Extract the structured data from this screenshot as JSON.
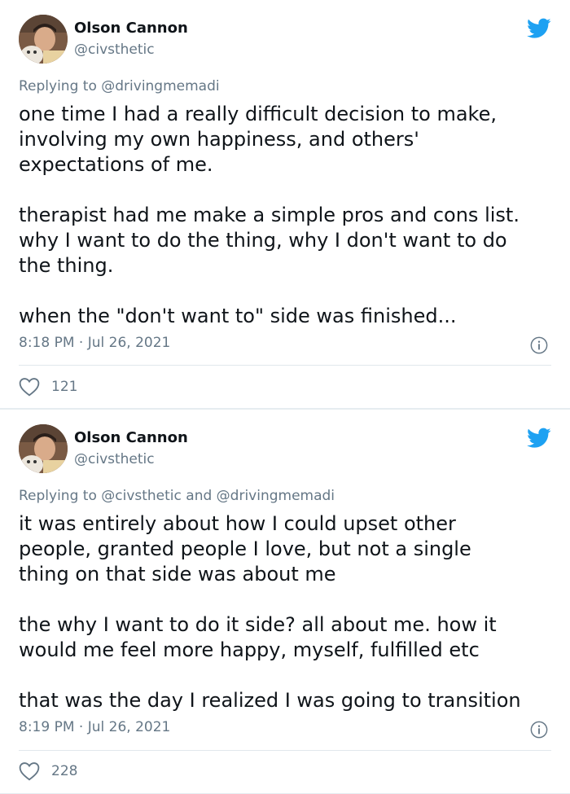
{
  "tweets": [
    {
      "author_name": "Olson Cannon",
      "author_handle": "@civsthetic",
      "replying_prefix": "Replying to ",
      "replying_to": "@drivingmemadi",
      "text": "one time I had a really difficult decision to make,\ninvolving my own happiness, and others'\nexpectations of me.\n\ntherapist had me make a simple pros and cons list.\nwhy I want to do the thing, why I don't want to do\nthe thing.\n\nwhen the \"don't want to\" side was finished...",
      "timestamp": "8:18 PM · Jul 26, 2021",
      "likes": "121"
    },
    {
      "author_name": "Olson Cannon",
      "author_handle": "@civsthetic",
      "replying_prefix": "Replying to ",
      "replying_to": "@civsthetic and @drivingmemadi",
      "text": "it was entirely about how I could upset other\npeople, granted people I love, but not a single\nthing on that side was about me\n\nthe why I want to do it side? all about me. how it\nwould me feel more happy, myself, fulfilled etc\n\nthat was the day I realized I was going to transition",
      "timestamp": "8:19 PM · Jul 26, 2021",
      "likes": "228"
    }
  ],
  "icons": {
    "brand": "twitter-bird-icon",
    "info": "info-icon",
    "like": "heart-icon"
  },
  "colors": {
    "brand_blue": "#1da1f2",
    "secondary_text": "#657786",
    "primary_text": "#0f1419",
    "divider": "#e1e8ed"
  }
}
